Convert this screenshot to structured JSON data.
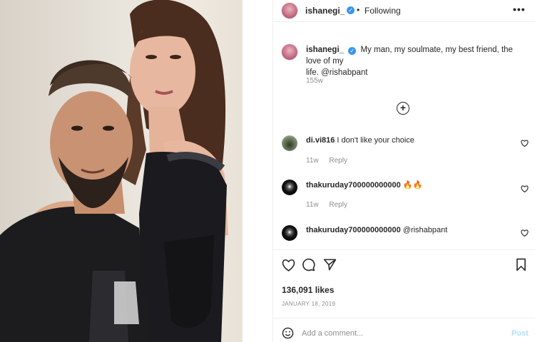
{
  "header": {
    "username": "ishanegi_",
    "separator": "•",
    "follow_status": "Following",
    "more_icon": "•••"
  },
  "caption": {
    "username": "ishanegi_",
    "text": "My man, my soulmate, my best friend, the love of my",
    "text_line2": "life. @rishabpant",
    "time": "155w"
  },
  "load_more_icon": "+",
  "comments": [
    {
      "username": "di.vi816",
      "text": "I don't like your choice",
      "time": "11w",
      "reply": "Reply"
    },
    {
      "username": "thakuruday700000000000",
      "text": "🔥🔥",
      "time": "11w",
      "reply": "Reply"
    },
    {
      "username": "thakuruday700000000000",
      "text": "@rishabpant"
    }
  ],
  "likes": "136,091 likes",
  "date": "JANUARY 18, 2019",
  "add_comment_placeholder": "Add a comment...",
  "post_label": "Post",
  "colors": {
    "verified": "#3897f0",
    "post_disabled": "#b2dffc",
    "muted": "#8e8e8e"
  }
}
